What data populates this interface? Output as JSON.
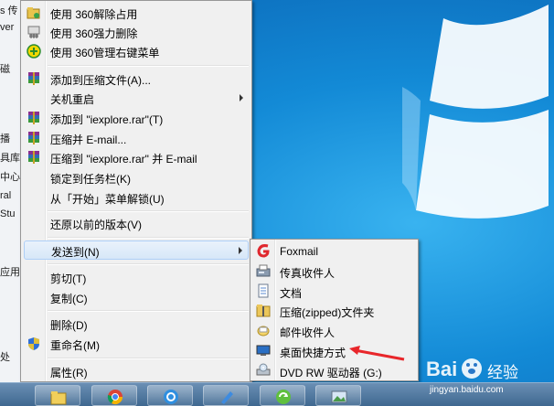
{
  "background_start_menu": {
    "fragments": [
      "s 传",
      "ver",
      "磁",
      "播",
      "具库",
      "中心",
      "ral",
      "Stu",
      "应用",
      "处"
    ]
  },
  "context_menu": {
    "items": [
      {
        "label": "使用 360解除占用",
        "icon": "folder-lock-icon"
      },
      {
        "label": "使用 360强力删除",
        "icon": "shred-icon"
      },
      {
        "label": "使用 360管理右键菜单",
        "icon": "360-plus-icon"
      },
      {
        "label": "添加到压缩文件(A)...",
        "icon": "winrar-icon"
      },
      {
        "label": "关机重启",
        "submenu": true
      },
      {
        "label": "添加到 \"iexplore.rar\"(T)",
        "icon": "winrar-icon"
      },
      {
        "label": "压缩并 E-mail...",
        "icon": "winrar-icon"
      },
      {
        "label": "压缩到 \"iexplore.rar\" 并 E-mail",
        "icon": "winrar-icon"
      },
      {
        "label": "锁定到任务栏(K)"
      },
      {
        "label": "从「开始」菜单解锁(U)"
      },
      {
        "label": "还原以前的版本(V)"
      },
      {
        "label": "发送到(N)",
        "submenu": true,
        "highlighted": true
      },
      {
        "label": "剪切(T)"
      },
      {
        "label": "复制(C)"
      },
      {
        "label": "删除(D)"
      },
      {
        "label": "重命名(M)",
        "icon": "uac-shield-icon"
      },
      {
        "label": "属性(R)"
      }
    ]
  },
  "send_to_menu": {
    "items": [
      {
        "label": "Foxmail",
        "icon": "foxmail-icon"
      },
      {
        "label": "传真收件人",
        "icon": "fax-icon"
      },
      {
        "label": "文档",
        "icon": "document-icon"
      },
      {
        "label": "压缩(zipped)文件夹",
        "icon": "zip-folder-icon"
      },
      {
        "label": "邮件收件人",
        "icon": "mail-icon"
      },
      {
        "label": "桌面快捷方式",
        "icon": "desktop-icon"
      },
      {
        "label": "DVD RW 驱动器 (G:)",
        "icon": "dvd-drive-icon"
      }
    ]
  },
  "taskbar": {
    "buttons": [
      "explorer-icon",
      "chrome-icon",
      "browser-icon",
      "pen-icon",
      "sync-icon",
      "image-viewer-icon"
    ]
  },
  "watermark": {
    "brand": "Bai",
    "brand_suffix": "经验",
    "url": "jingyan.baidu.com"
  },
  "colors": {
    "desktop": "#138ad6",
    "menu_bg": "#f0f0f0",
    "highlight": "#d7e7f8",
    "arrow": "#e8262a"
  }
}
